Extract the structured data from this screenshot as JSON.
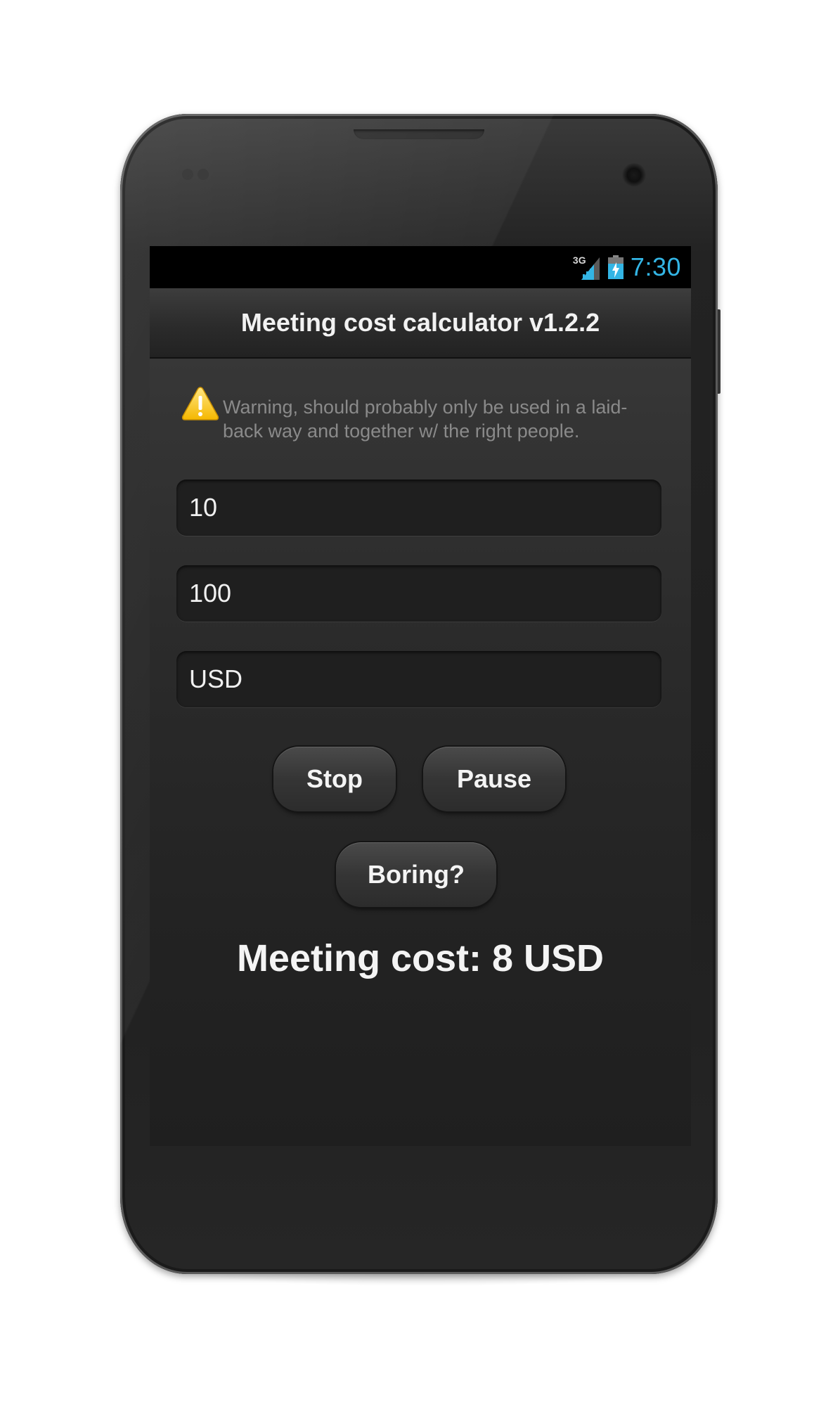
{
  "status_bar": {
    "network_type": "3G",
    "time": "7:30",
    "signal_icon": "signal-bars-icon",
    "battery_icon": "battery-charging-icon",
    "battery_level": 0.7
  },
  "app_bar": {
    "title": "Meeting cost calculator v1.2.2"
  },
  "warning": {
    "icon": "warning-icon",
    "text": "Warning, should probably only be used in a laid-back way and together w/ the right people."
  },
  "form": {
    "participants_value": "10",
    "hourly_rate_value": "100",
    "currency_value": "USD"
  },
  "buttons": {
    "stop_label": "Stop",
    "pause_label": "Pause",
    "boring_label": "Boring?"
  },
  "result": {
    "text": "Meeting cost: 8 USD"
  },
  "colors": {
    "accent": "#33b5e5",
    "background": "#2b2b2b",
    "text": "#f4f4f4",
    "muted_text": "#8a8a8a"
  }
}
